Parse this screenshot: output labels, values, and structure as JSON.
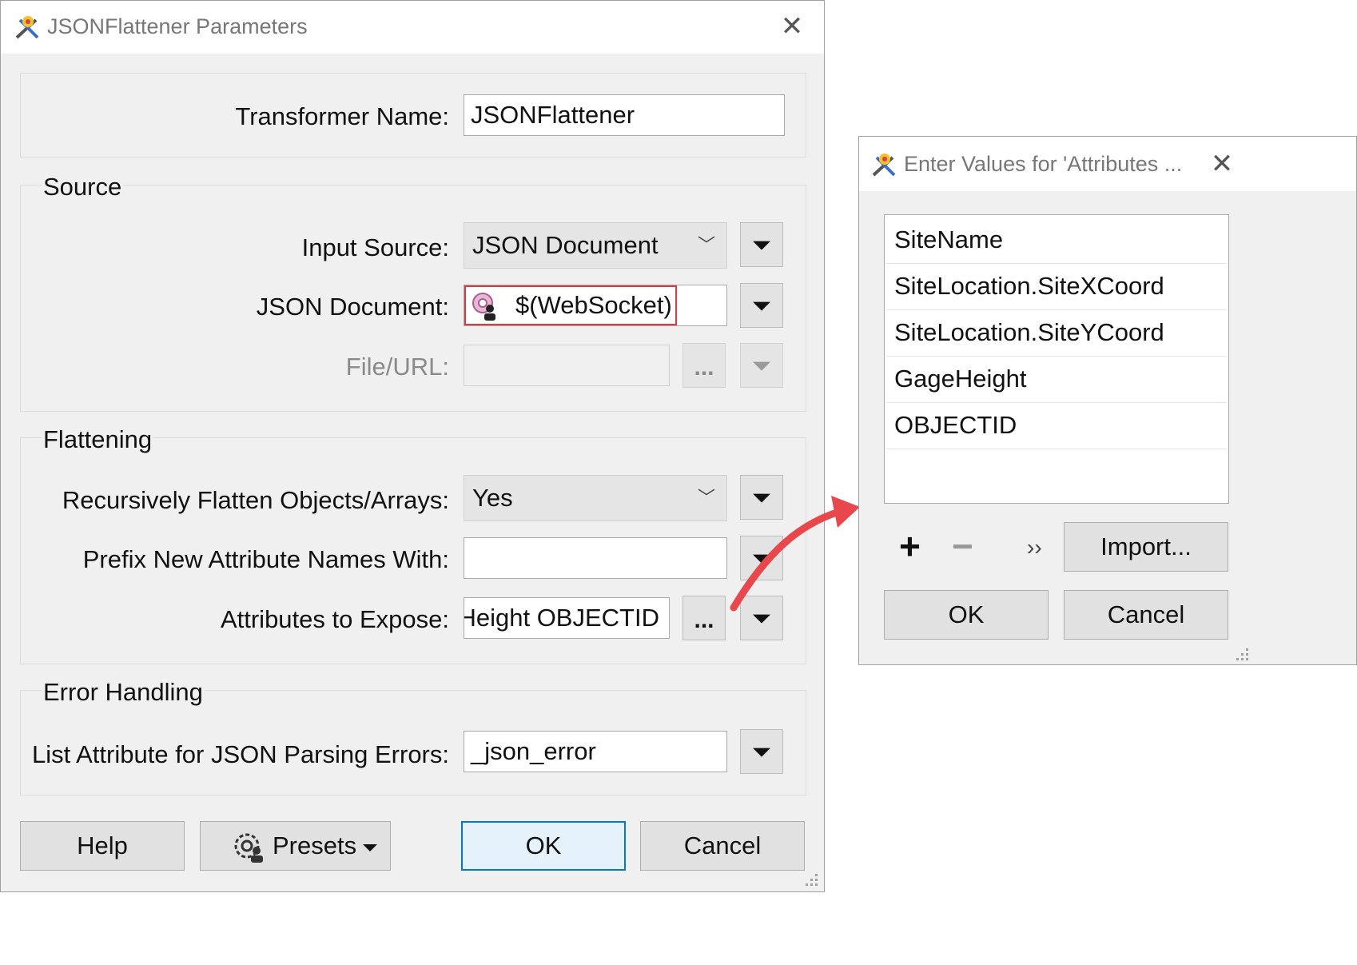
{
  "main_dialog": {
    "title": "JSONFlattener Parameters",
    "transformer_name_label": "Transformer Name:",
    "transformer_name_value": "JSONFlattener",
    "source": {
      "heading": "Source",
      "input_source_label": "Input Source:",
      "input_source_value": "JSON Document",
      "json_document_label": "JSON Document:",
      "json_document_value": "$(WebSocket)",
      "file_url_label": "File/URL:",
      "file_url_value": "",
      "browse_label": "..."
    },
    "flattening": {
      "heading": "Flattening",
      "recursive_label": "Recursively Flatten Objects/Arrays:",
      "recursive_value": "Yes",
      "prefix_label": "Prefix New Attribute Names With:",
      "prefix_value": "",
      "expose_label": "Attributes to Expose:",
      "expose_value": "eHeight OBJECTID",
      "browse_label": "..."
    },
    "error_handling": {
      "heading": "Error Handling",
      "list_attr_label": "List Attribute for JSON Parsing Errors:",
      "list_attr_value": "_json_error"
    },
    "buttons": {
      "help": "Help",
      "presets": "Presets",
      "ok": "OK",
      "cancel": "Cancel"
    }
  },
  "values_dialog": {
    "title": "Enter Values for 'Attributes ...",
    "items": [
      "SiteName",
      "SiteLocation.SiteXCoord",
      "SiteLocation.SiteYCoord",
      "GageHeight",
      "OBJECTID",
      ""
    ],
    "add_symbol": "+",
    "remove_symbol": "−",
    "more_symbol": "››",
    "import": "Import...",
    "ok": "OK",
    "cancel": "Cancel"
  },
  "colors": {
    "highlight_border": "#e03a3e",
    "arrow": "#e8474b",
    "primary_border": "#0078d7"
  }
}
